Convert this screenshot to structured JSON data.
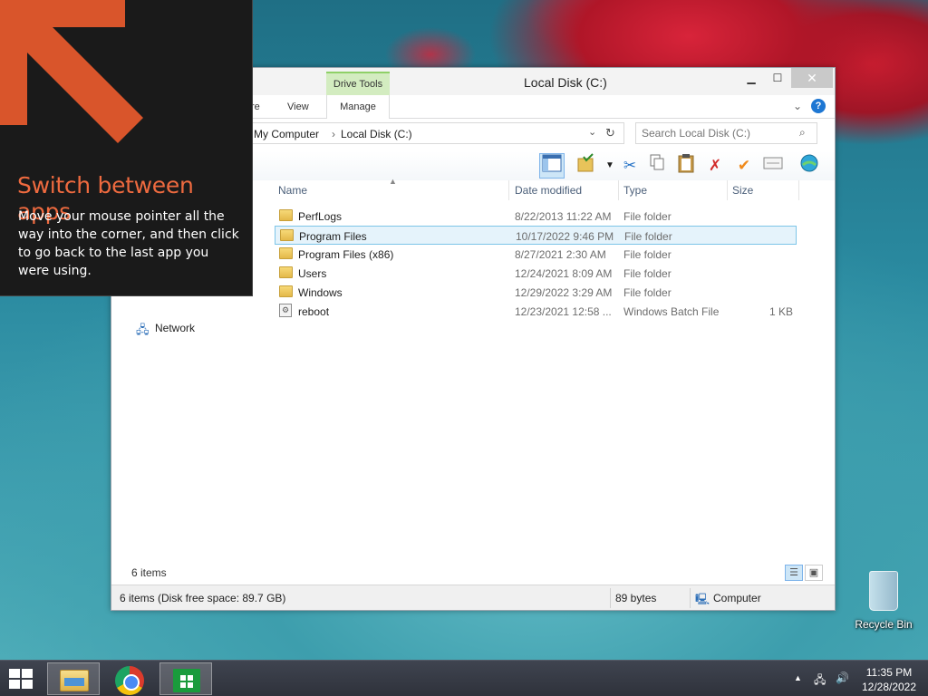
{
  "window": {
    "title": "Local Disk (C:)",
    "minimize": "▁",
    "maximize": "☐",
    "close": "✕"
  },
  "ribbon": {
    "context_group": "Drive Tools",
    "tabs": [
      "re",
      "View"
    ],
    "manage_tab": "Manage",
    "collapse": "⌄",
    "help": "?"
  },
  "address": {
    "crumbs": [
      "My Computer",
      "Local Disk (C:)"
    ],
    "separator": "›",
    "dropdown": "⌄",
    "refresh": "↻"
  },
  "search": {
    "placeholder": "Search Local Disk (C:)"
  },
  "columns": {
    "name": "Name",
    "date": "Date modified",
    "type": "Type",
    "size": "Size"
  },
  "files": [
    {
      "name": "PerfLogs",
      "date": "8/22/2013 11:22 AM",
      "type": "File folder",
      "size": "",
      "icon": "folder"
    },
    {
      "name": "Program Files",
      "date": "10/17/2022 9:46 PM",
      "type": "File folder",
      "size": "",
      "icon": "folder",
      "selected": true
    },
    {
      "name": "Program Files (x86)",
      "date": "8/27/2021 2:30 AM",
      "type": "File folder",
      "size": "",
      "icon": "folder"
    },
    {
      "name": "Users",
      "date": "12/24/2021 8:09 AM",
      "type": "File folder",
      "size": "",
      "icon": "folder"
    },
    {
      "name": "Windows",
      "date": "12/29/2022 3:29 AM",
      "type": "File folder",
      "size": "",
      "icon": "folder"
    },
    {
      "name": "reboot",
      "date": "12/23/2021 12:58 ...",
      "type": "Windows Batch File",
      "size": "1 KB",
      "icon": "batch-file"
    }
  ],
  "nav": {
    "network": "Network"
  },
  "items_count": "6 items",
  "status": {
    "summary": "6 items (Disk free space: 89.7 GB)",
    "bytes": "89 bytes",
    "location": "Computer"
  },
  "tip": {
    "title": "Switch between apps",
    "body": "Move your mouse pointer all the way into the corner, and then click to go back to the last app you were using.",
    "accent": "#ee6a3f"
  },
  "desktop": {
    "recycle_bin": "Recycle Bin"
  },
  "taskbar": {
    "time": "11:35 PM",
    "date": "12/28/2022",
    "tray_arrow": "▲"
  }
}
